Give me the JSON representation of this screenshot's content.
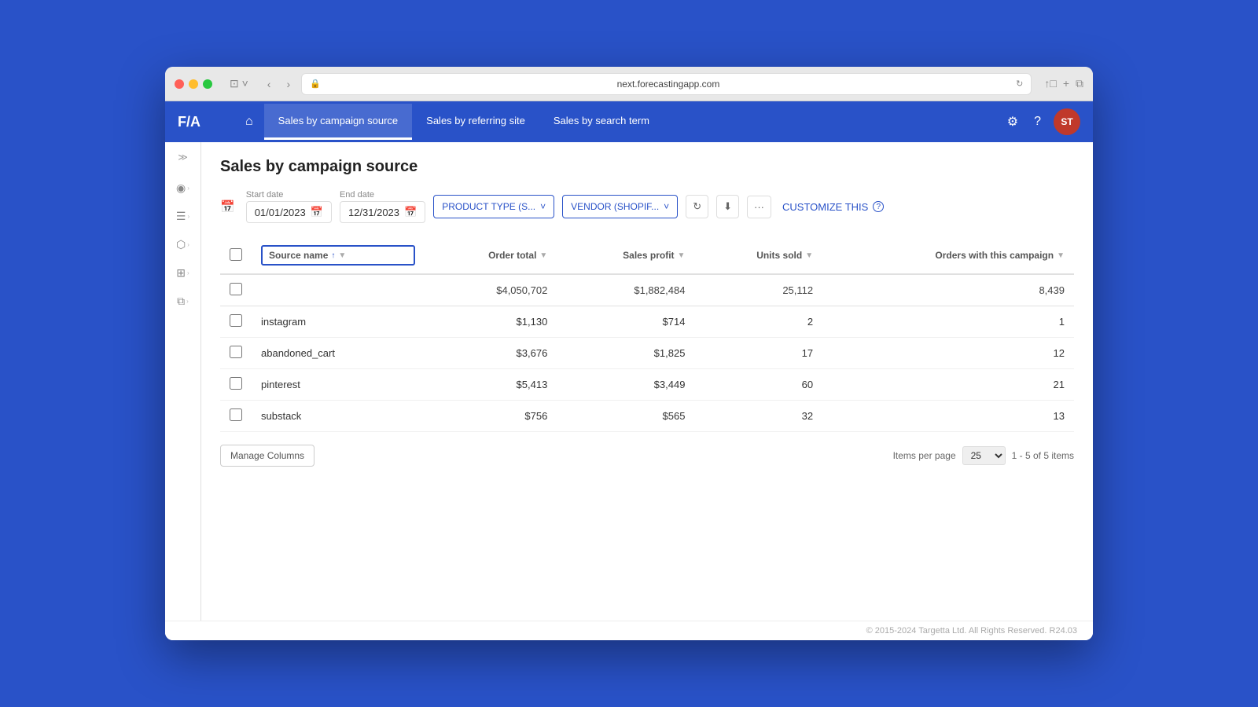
{
  "browser": {
    "url": "next.forecastingapp.com",
    "nav_back": "‹",
    "nav_forward": "›"
  },
  "app": {
    "logo": "F/A",
    "nav_tabs": [
      {
        "id": "campaign",
        "label": "Sales by campaign source",
        "active": true
      },
      {
        "id": "referring",
        "label": "Sales by referring site",
        "active": false
      },
      {
        "id": "search",
        "label": "Sales by search term",
        "active": false
      }
    ],
    "avatar_initials": "ST"
  },
  "page": {
    "title": "Sales by campaign source",
    "start_date_label": "Start date",
    "start_date_value": "01/01/2023",
    "end_date_label": "End date",
    "end_date_value": "12/31/2023",
    "filter_product": "PRODUCT TYPE (S...",
    "filter_vendor": "VENDOR (SHOPIF...",
    "customize_label": "CUSTOMIZE THIS"
  },
  "table": {
    "columns": [
      {
        "id": "source",
        "label": "Source name",
        "sortable": true,
        "filterable": true
      },
      {
        "id": "order_total",
        "label": "Order total",
        "sortable": false,
        "filterable": true
      },
      {
        "id": "sales_profit",
        "label": "Sales profit",
        "sortable": false,
        "filterable": true
      },
      {
        "id": "units_sold",
        "label": "Units sold",
        "sortable": false,
        "filterable": true
      },
      {
        "id": "orders",
        "label": "Orders with this campaign",
        "sortable": false,
        "filterable": true
      }
    ],
    "total_row": {
      "source": "",
      "order_total": "$4,050,702",
      "sales_profit": "$1,882,484",
      "units_sold": "25,112",
      "orders": "8,439"
    },
    "rows": [
      {
        "source": "instagram",
        "order_total": "$1,130",
        "sales_profit": "$714",
        "units_sold": "2",
        "orders": "1"
      },
      {
        "source": "abandoned_cart",
        "order_total": "$3,676",
        "sales_profit": "$1,825",
        "units_sold": "17",
        "orders": "12"
      },
      {
        "source": "pinterest",
        "order_total": "$5,413",
        "sales_profit": "$3,449",
        "units_sold": "60",
        "orders": "21"
      },
      {
        "source": "substack",
        "order_total": "$756",
        "sales_profit": "$565",
        "units_sold": "32",
        "orders": "13"
      }
    ],
    "manage_columns_label": "Manage Columns",
    "items_per_page_label": "Items per page",
    "items_per_page_value": "25",
    "pagination_text": "1 - 5 of 5 items"
  },
  "footer": {
    "text": "© 2015-2024 Targetta Ltd. All Rights Reserved. R24.03"
  },
  "sidebar": {
    "items": [
      {
        "id": "toggle",
        "icon": "≫"
      },
      {
        "id": "analytics",
        "icon": "◉"
      },
      {
        "id": "reports",
        "icon": "☰"
      },
      {
        "id": "products",
        "icon": "⬡"
      },
      {
        "id": "documents",
        "icon": "⊞"
      },
      {
        "id": "copy",
        "icon": "⧉"
      }
    ]
  }
}
